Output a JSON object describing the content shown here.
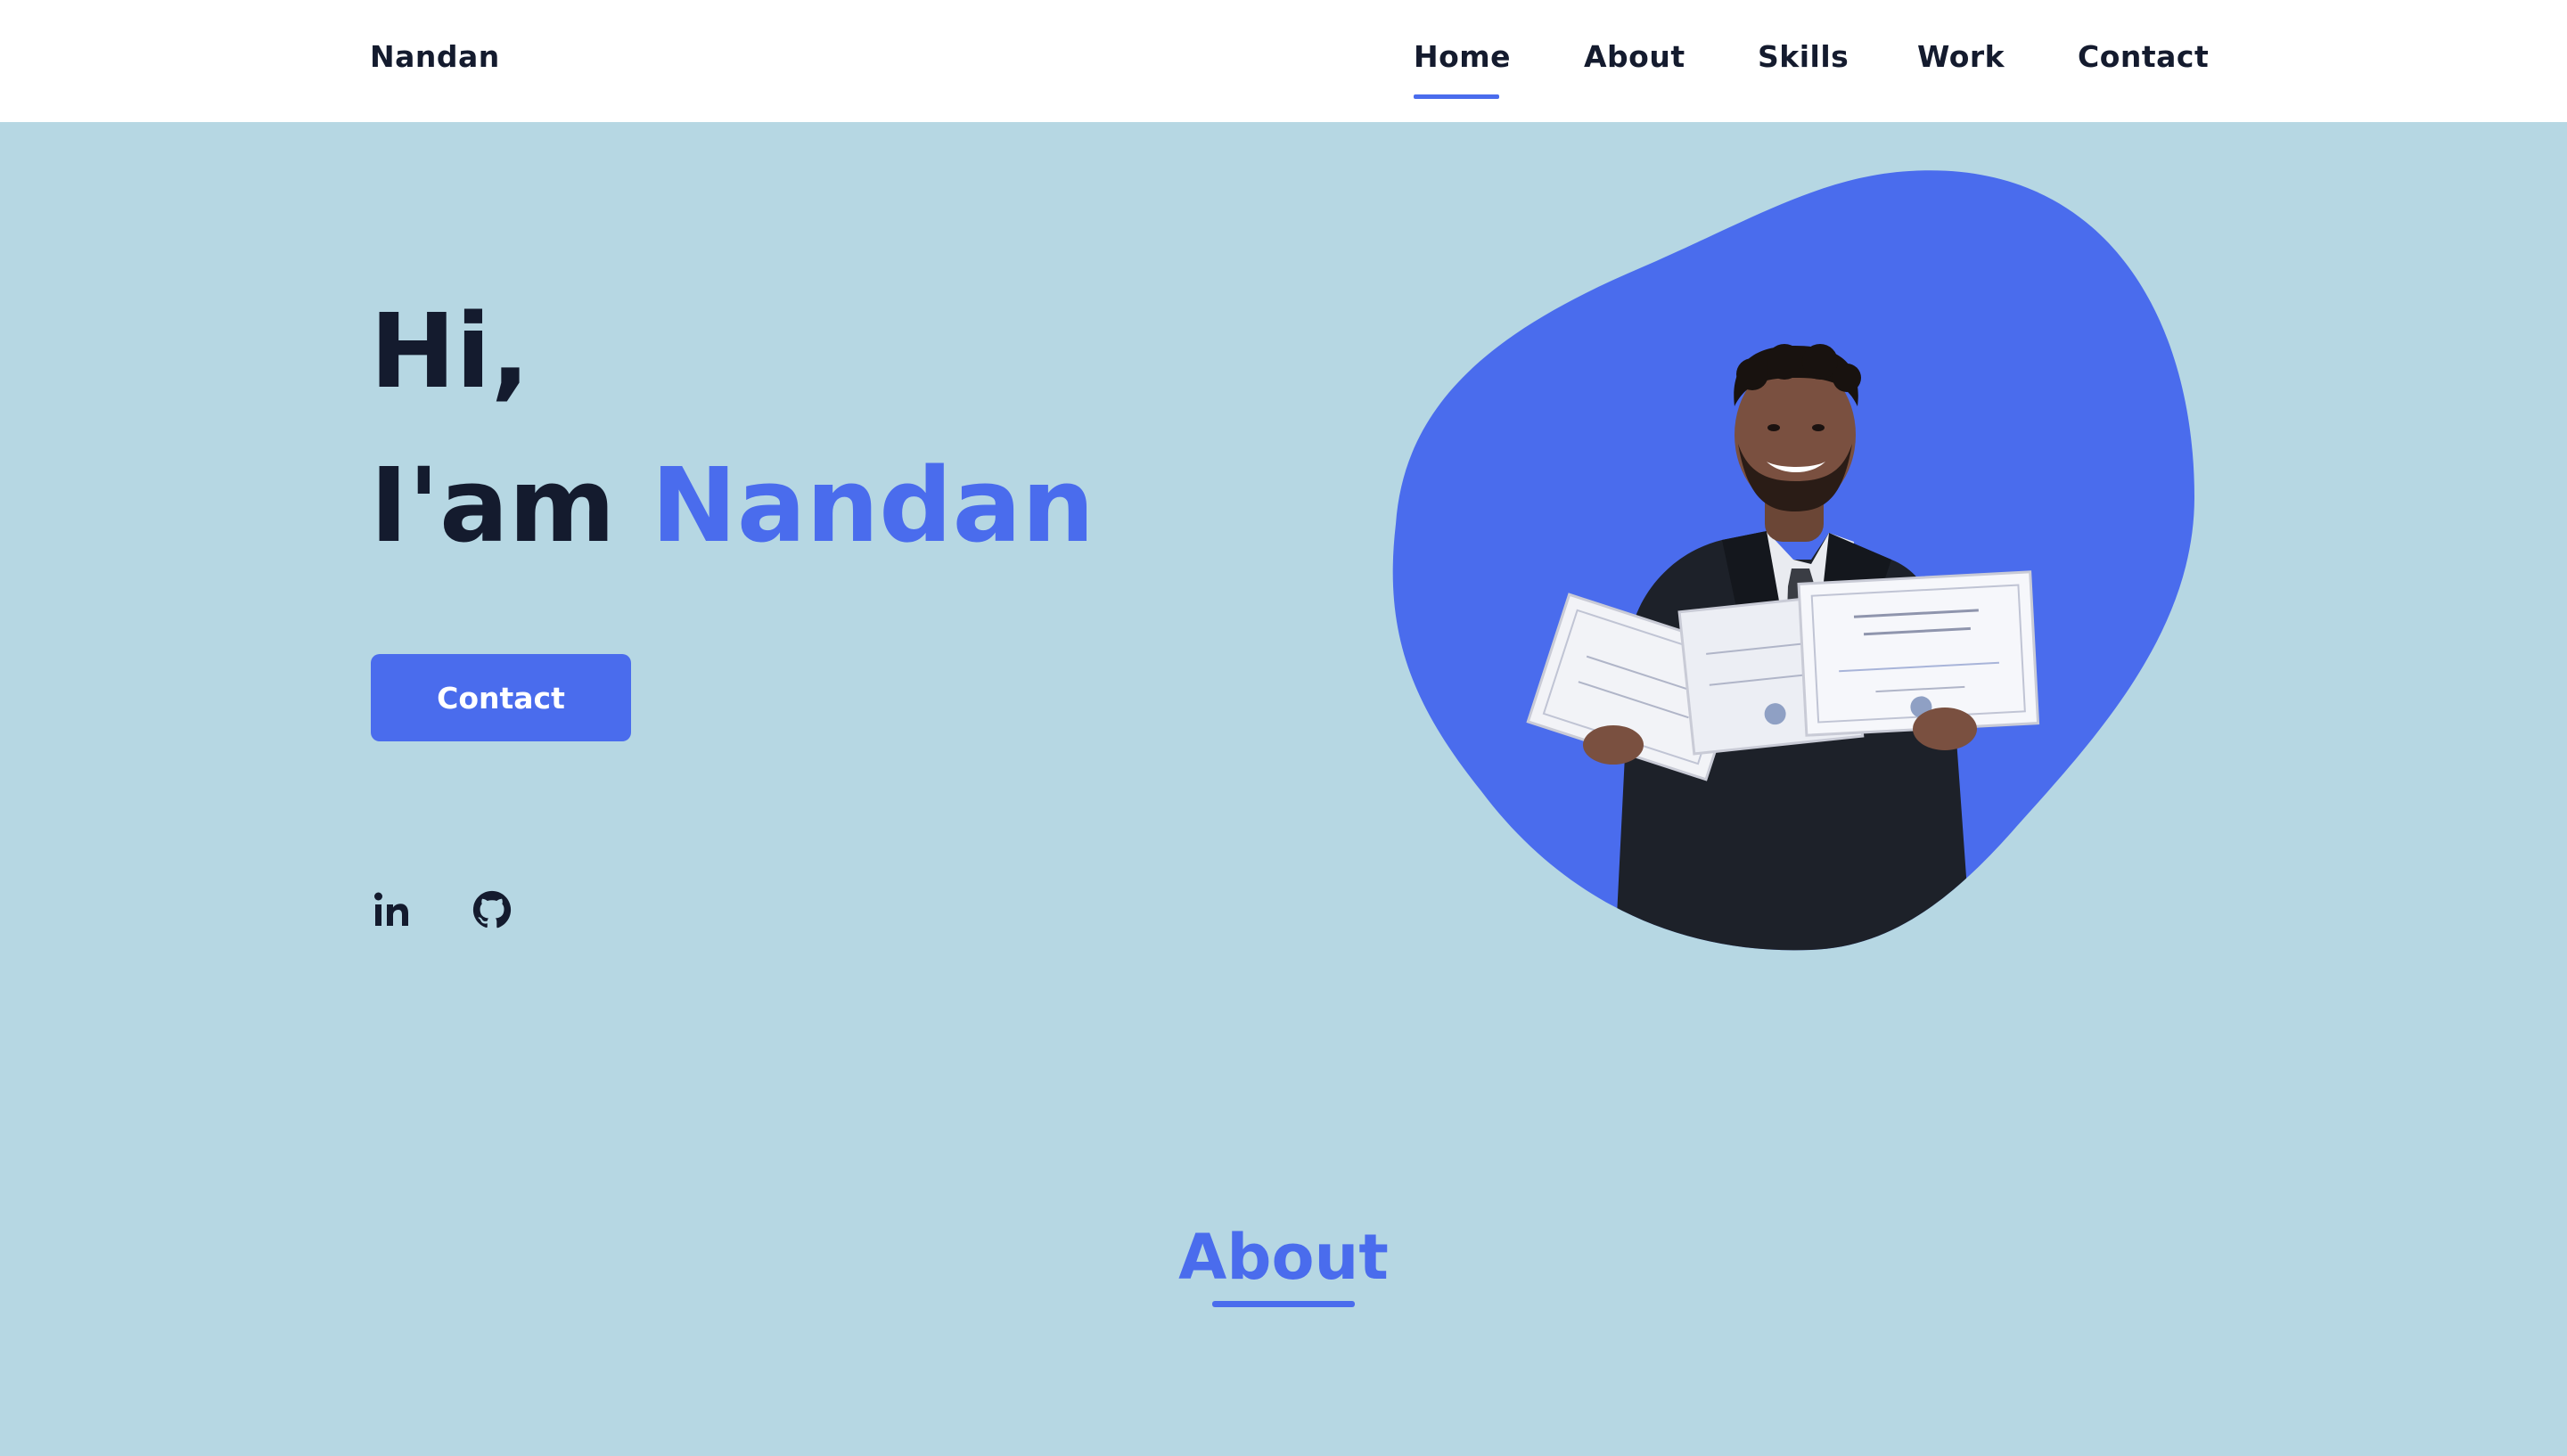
{
  "header": {
    "logo": "Nandan",
    "nav": [
      "Home",
      "About",
      "Skills",
      "Work",
      "Contact"
    ],
    "active": "Home"
  },
  "hero": {
    "greeting": "Hi,",
    "intro_prefix": "I'am ",
    "name": "Nandan",
    "cta_label": "Contact"
  },
  "social": [
    {
      "icon": "linkedin-icon",
      "label": "in"
    },
    {
      "icon": "github-icon"
    }
  ],
  "about": {
    "title": "About"
  },
  "colors": {
    "accent": "#4a6ced",
    "background": "#b6d7e3",
    "header": "#ffffff",
    "text": "#141b2e"
  }
}
